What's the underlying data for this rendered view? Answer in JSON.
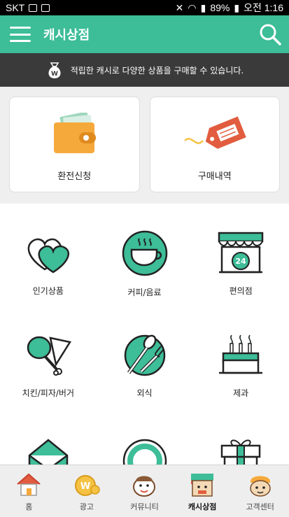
{
  "status": {
    "carrier": "SKT",
    "battery": "89%",
    "time": "오전 1:16"
  },
  "header": {
    "title": "캐시상점"
  },
  "notice": {
    "text": "적립한 캐시로 다양한 상품을 구매할 수 있습니다."
  },
  "top_cards": [
    {
      "label": "환전신청",
      "icon": "wallet-icon"
    },
    {
      "label": "구매내역",
      "icon": "tag-icon"
    }
  ],
  "categories": [
    {
      "label": "인기상품",
      "icon": "hearts-icon"
    },
    {
      "label": "커피/음료",
      "icon": "coffee-cup-icon"
    },
    {
      "label": "편의점",
      "icon": "convenience-store-icon"
    },
    {
      "label": "치킨/피자/버거",
      "icon": "chicken-pizza-icon"
    },
    {
      "label": "외식",
      "icon": "fork-spoon-icon"
    },
    {
      "label": "제과",
      "icon": "cake-icon"
    }
  ],
  "bottom_nav": [
    {
      "label": "홈",
      "icon": "house-icon"
    },
    {
      "label": "광고",
      "icon": "coin-icon"
    },
    {
      "label": "커뮤니티",
      "icon": "community-character-icon"
    },
    {
      "label": "캐시상점",
      "icon": "shop-character-icon",
      "active": true
    },
    {
      "label": "고객센터",
      "icon": "support-character-icon"
    }
  ],
  "colors": {
    "accent": "#3dbd98",
    "notice_bg": "#3a3a3a",
    "wallet": "#f5a93b",
    "tag": "#e25c3f"
  }
}
